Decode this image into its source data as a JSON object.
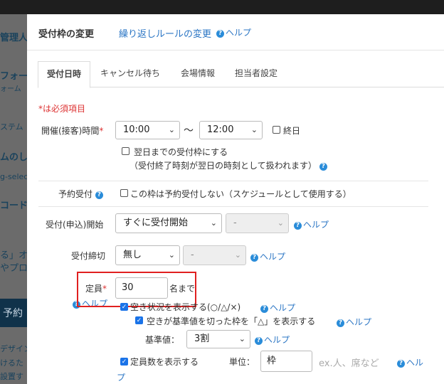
{
  "background": {
    "lines": [
      "管理人",
      "フォー",
      "ォーム",
      "ステム",
      "ムのし",
      "g-selec",
      "コード",
      "る」オ",
      "やプロ",
      "予約",
      "デザイン",
      "けるた",
      "設置す"
    ]
  },
  "modal": {
    "title": "受付枠の変更",
    "repeat_rule_link": "繰り返しルールの変更",
    "help_label": "ヘルプ",
    "tabs": [
      "受付日時",
      "キャンセル待ち",
      "会場情報",
      "担当者設定"
    ],
    "required_note": "*は必須項目",
    "time": {
      "label": "開催(接客)時間",
      "start": "10:00",
      "separator": "〜",
      "end": "12:00",
      "all_day_label": "終日",
      "next_day_label": "翌日までの受付枠にする",
      "next_day_note": "（受付終了時刻が翌日の時刻として扱われます）"
    },
    "reservation": {
      "label": "予約受付",
      "no_reservation_label": "この枠は予約受付しない（スケジュールとして使用する）"
    },
    "start": {
      "label": "受付(申込)開始",
      "value": "すぐに受付開始",
      "sub_value": "-",
      "help": "ヘルプ"
    },
    "deadline": {
      "label": "受付締切",
      "value": "無し",
      "sub_value": "-",
      "help": "ヘルプ"
    },
    "capacity": {
      "label": "定員",
      "value": "30",
      "unit": "名まで",
      "help": "ヘルプ",
      "show_vacancy_label": "空き状況を表示する(○/△/×)",
      "show_vacancy_help": "ヘルプ",
      "threshold_label": "空きが基準値を切った枠を「△」を表示する",
      "threshold_help": "ヘルプ",
      "base_label": "基準値：",
      "base_value": "3割",
      "base_help": "ヘルプ",
      "show_count_label": "定員数を表示する",
      "unit_label": "単位：",
      "unit_value": "枠",
      "unit_placeholder": "ex.人、席など",
      "count_help_1": "ヘル",
      "count_help_2": "プ"
    }
  }
}
